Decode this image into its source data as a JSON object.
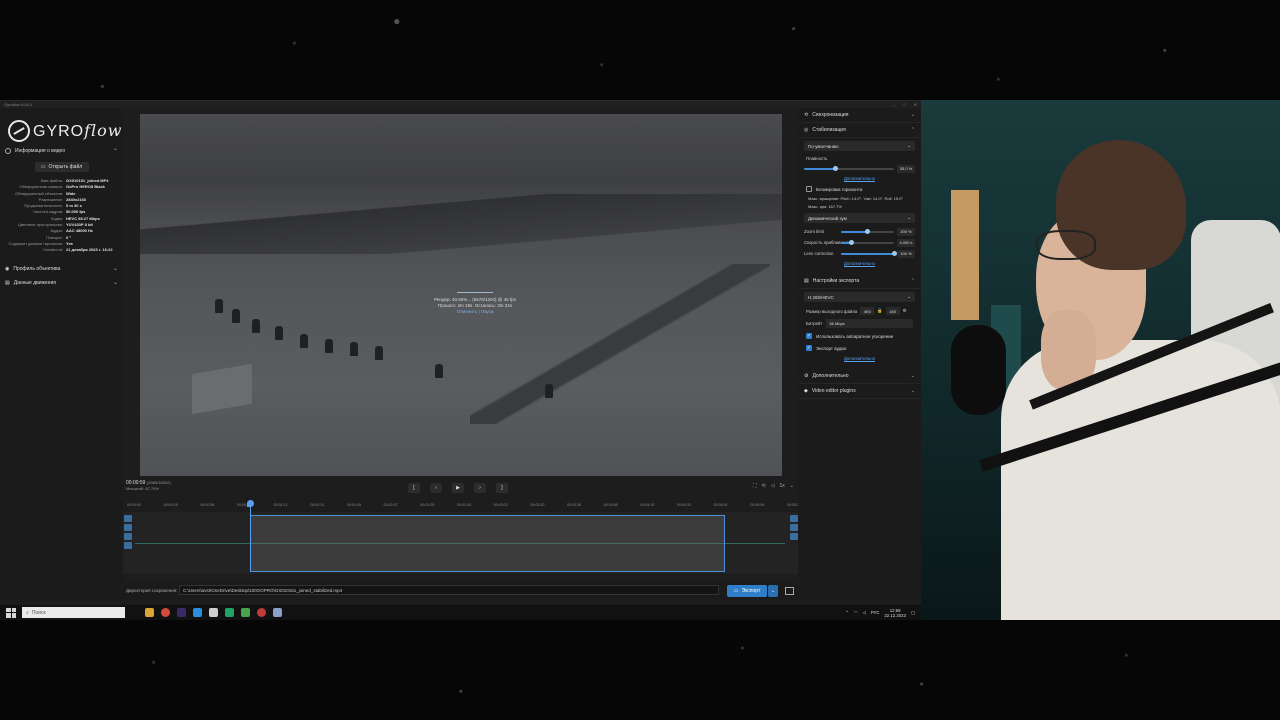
{
  "window": {
    "title": "Gyroflow v1.6.0"
  },
  "logo": {
    "text_main": "GYRO",
    "text_script": "flow"
  },
  "left_panel": {
    "video_info_title": "Информация о видео",
    "open_file_label": "Открыть файл",
    "info_rows": [
      {
        "k": "Имя файла:",
        "v": "GX010151_joined.MP4"
      },
      {
        "k": "Обнаруженная камера:",
        "v": "GoPro HERO8 Black"
      },
      {
        "k": "Обнаруженный объектив:",
        "v": "Wide"
      },
      {
        "k": "Разрешение:",
        "v": "2840x2160"
      },
      {
        "k": "Продолжительность:",
        "v": "5 m 30 s"
      },
      {
        "k": "Частота кадров:",
        "v": "50.000 fps"
      },
      {
        "k": "Кодек:",
        "v": "HEVC 85.27 Mbps"
      },
      {
        "k": "Цветовое пространство:",
        "v": "YUV420P 8 bit"
      },
      {
        "k": "Аудио:",
        "v": "AAC 48000 Hz"
      },
      {
        "k": "Поворот:",
        "v": "0 °"
      },
      {
        "k": "Содержит данные гироскопа:",
        "v": "Yes"
      },
      {
        "k": "Created at:",
        "v": "21 декабря 2023 г. 16:22"
      }
    ],
    "lens_profile_title": "Профиль объектива",
    "motion_data_title": "Данные движения"
  },
  "render": {
    "line1": "Рендер: 40.65%... (5676/1204) @ 45 fps",
    "line2": "Прошло: 2m 19s. Осталось: 3m 24s",
    "cancel": "Отменить",
    "pause": "Пауза"
  },
  "transport": {
    "time": "00:00:59",
    "frame": "(2969/16502)",
    "zoom": "Масштаб: 67.74%",
    "prev_frame": "[",
    "step_back": "‹",
    "play": "▶",
    "step_fwd": "›",
    "next_frame": "]",
    "speed": "1x"
  },
  "ruler": [
    "00:00:00",
    "00:00:18",
    "00:00:36",
    "00:00:54",
    "00:01:12",
    "00:01:31",
    "00:01:49",
    "00:02:07",
    "00:02:25",
    "00:02:44",
    "00:03:02",
    "00:03:20",
    "00:03:38",
    "00:03:56",
    "00:04:15",
    "00:04:33",
    "00:04:51",
    "00:05:09",
    "00:05:29"
  ],
  "bottom": {
    "out_label": "Директория сохранения:",
    "out_path": "C:\\Users\\avst\\OneDrive\\Desktop\\100GOPRO\\GX010151_joined_stabilized.mp4",
    "export_label": "Экспорт"
  },
  "right_panel": {
    "sync_title": "Синхронизация",
    "stab_title": "Стабилизация",
    "stab_method": "По-умолчанию",
    "smoothness_label": "Плавность",
    "smoothness_value": "35.0 %",
    "smoothness_fraction": 0.35,
    "advanced_1": "Дополнительно",
    "horizon_lock": "Блокировка горизонта",
    "max_rotation": "Макс. вращение: Pitch: 14.0°, Yaw: 14.0°, Roll: 15.0°",
    "max_zoom": "Макс. зум: 167.7%",
    "zoom_mode": "Динамический зум",
    "zoom_limit_label": "Zoom limit",
    "zoom_limit_value": "200 %",
    "zoom_limit_fraction": 0.5,
    "zoom_speed_label": "Скорость приближения",
    "zoom_speed_value": "4.000 s",
    "zoom_speed_fraction": 0.2,
    "lens_corr_label": "Lens correction",
    "lens_corr_value": "100 %",
    "lens_corr_fraction": 1.0,
    "advanced_2": "Дополнительно",
    "export_title": "Настройки экспорта",
    "codec": "H.265/HEVC",
    "output_size_label": "Размер выходного файла",
    "out_w": "4K0",
    "out_h": "160",
    "bitrate_label": "Битрейт",
    "bitrate_value": "36 Mbps",
    "hw_accel": "Использовать аппаратное ускорение",
    "export_audio": "Экспорт аудио",
    "advanced_3": "Дополнительно",
    "extra_title": "Дополнительно",
    "plugins_title": "Video editor plugins"
  },
  "taskbar": {
    "search_placeholder": "Поиск",
    "lang": "РУС",
    "time": "12:59",
    "date": "22.12.2023"
  }
}
